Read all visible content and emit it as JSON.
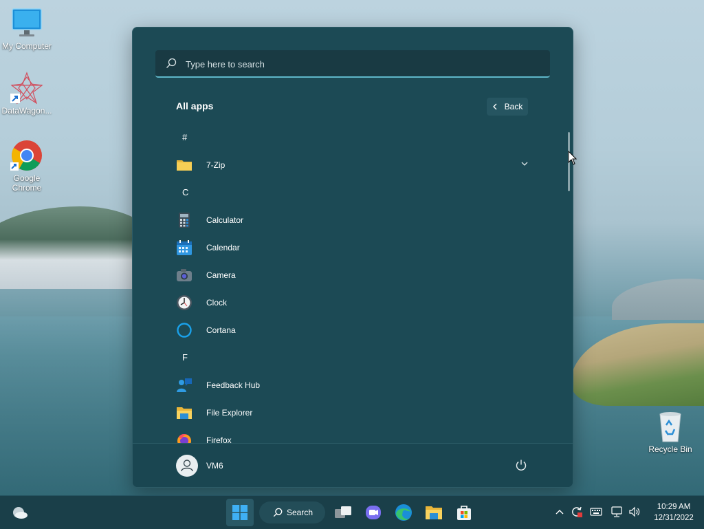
{
  "desktop": {
    "icons": [
      {
        "label": "My Computer"
      },
      {
        "label": "DataWagon..."
      },
      {
        "label": "Google Chrome"
      },
      {
        "label": "Recycle Bin"
      }
    ]
  },
  "start_menu": {
    "search_placeholder": "Type here to search",
    "title": "All apps",
    "back_label": "Back",
    "sections": [
      {
        "letter": "#"
      },
      {
        "letter": "C"
      },
      {
        "letter": "F"
      }
    ],
    "apps": [
      {
        "label": "7-Zip",
        "icon": "folder-icon",
        "expandable": true
      },
      {
        "label": "Calculator",
        "icon": "calculator-icon"
      },
      {
        "label": "Calendar",
        "icon": "calendar-icon"
      },
      {
        "label": "Camera",
        "icon": "camera-icon"
      },
      {
        "label": "Clock",
        "icon": "clock-icon"
      },
      {
        "label": "Cortana",
        "icon": "cortana-icon"
      },
      {
        "label": "Feedback Hub",
        "icon": "feedback-hub-icon"
      },
      {
        "label": "File Explorer",
        "icon": "file-explorer-icon"
      },
      {
        "label": "Firefox",
        "icon": "firefox-icon"
      }
    ],
    "user": {
      "name": "VM6"
    }
  },
  "taskbar": {
    "search_label": "Search",
    "time": "10:29 AM",
    "date": "12/31/2022"
  },
  "colors": {
    "start_bg": "#1c4a55",
    "accent": "#5fb7c9",
    "taskbar_bg": "#1a3f49"
  }
}
